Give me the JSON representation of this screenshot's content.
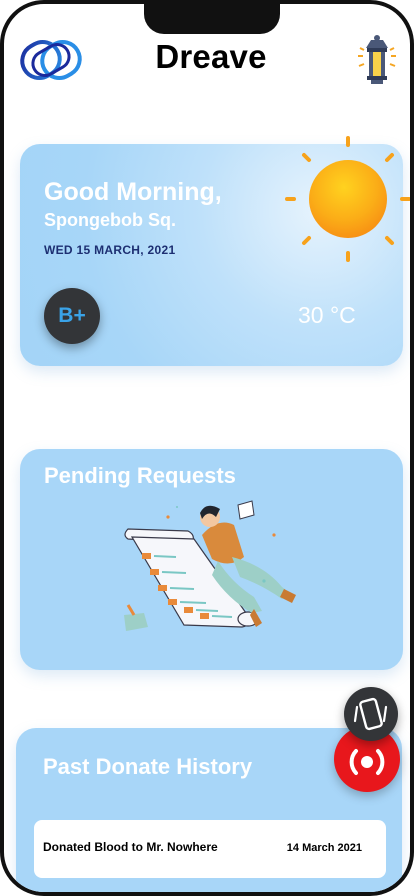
{
  "header": {
    "app_title": "Dreave",
    "logo_icon": "dreave-logo-icon",
    "lamp_icon": "lamp-icon"
  },
  "weather": {
    "greeting": "Good Morning,",
    "username": "Spongebob Sq.",
    "date": "WED 15 MARCH, 2021",
    "blood_group": "B+",
    "temperature": "30 °C",
    "weather_icon": "sun-icon"
  },
  "pending": {
    "title": "Pending Requests",
    "illustration": "person-with-checklist-illustration"
  },
  "history": {
    "title": "Past Donate History",
    "items": [
      {
        "text": "Donated Blood to Mr. Nowhere",
        "date": "14 March 2021"
      }
    ]
  },
  "fabs": {
    "vibrate_icon": "vibrate-phone-icon",
    "alert_icon": "emergency-broadcast-icon"
  },
  "colors": {
    "card_blue": "#a8d6f8",
    "date_navy": "#1d2f72",
    "badge_dark": "#333538",
    "badge_text": "#3aa3e8",
    "alert_red": "#e8171c",
    "sun_orange": "#fb9a16"
  }
}
